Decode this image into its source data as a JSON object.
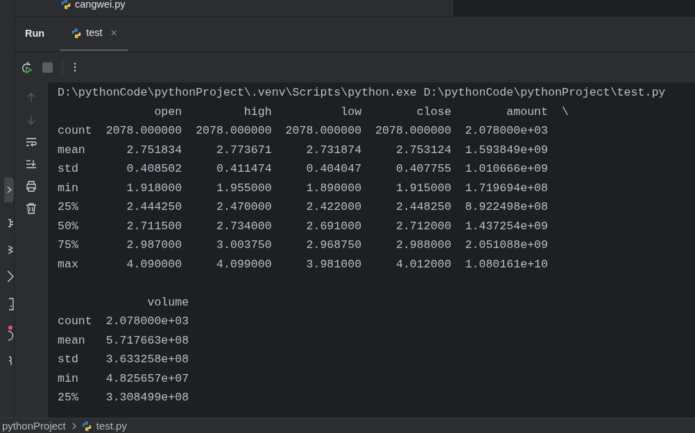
{
  "project_tree": {
    "items": [
      {
        "label": "cangwei.py"
      }
    ]
  },
  "run_panel": {
    "title": "Run",
    "tabs": [
      {
        "label": "test",
        "selected": true,
        "close": "×"
      }
    ],
    "toolbar": [
      {
        "kind": "rerun"
      },
      {
        "kind": "stop",
        "disabled": true
      },
      {
        "kind": "more"
      }
    ],
    "side_actions": [
      {
        "kind": "up",
        "disabled": true
      },
      {
        "kind": "down",
        "disabled": true
      },
      {
        "kind": "wrap",
        "disabled": false
      },
      {
        "kind": "scroll-end",
        "disabled": false
      },
      {
        "kind": "print",
        "disabled": false
      },
      {
        "kind": "clear",
        "disabled": false
      }
    ],
    "output_blocks": [
      [
        "D:\\pythonCode\\pythonProject\\.venv\\Scripts\\python.exe D:\\pythonCode\\pythonProject\\test.py",
        "              open         high          low        close        amount  \\",
        "count  2078.000000  2078.000000  2078.000000  2078.000000  2.078000e+03",
        "mean      2.751834     2.773671     2.731874     2.753124  1.593849e+09",
        "std       0.408502     0.411474     0.404047     0.407755  1.010666e+09",
        "min       1.918000     1.955000     1.890000     1.915000  1.719694e+08",
        "25%       2.444250     2.470000     2.422000     2.448250  8.922498e+08",
        "50%       2.711500     2.734000     2.691000     2.712000  1.437254e+09",
        "75%       2.987000     3.003750     2.968750     2.988000  2.051088e+09",
        "max       4.090000     4.099000     3.981000     4.012000  1.080161e+10"
      ],
      [
        "             volume",
        "count  2.078000e+03",
        "mean   5.717663e+08",
        "std    3.633258e+08",
        "min    4.825657e+07",
        "25%    3.308499e+08"
      ]
    ]
  },
  "status_bar": {
    "breadcrumbs": [
      {
        "label": "pythonProject",
        "kind": "folder"
      },
      {
        "label": "test.py",
        "kind": "python"
      }
    ]
  }
}
